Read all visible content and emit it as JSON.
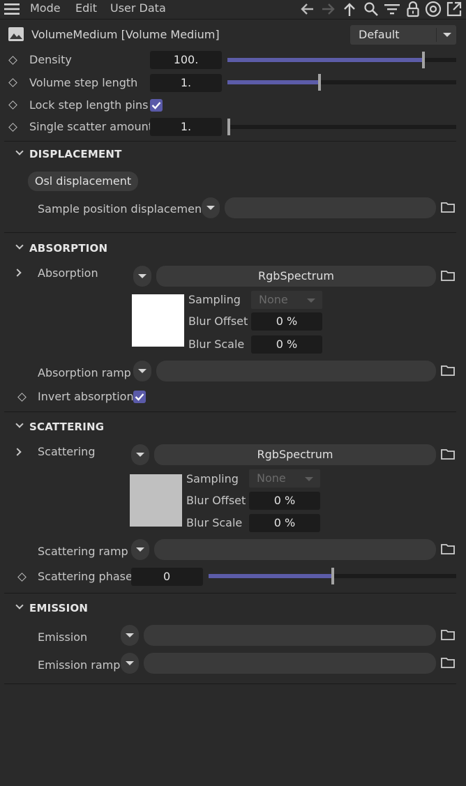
{
  "menu": {
    "mode": "Mode",
    "edit": "Edit",
    "user_data": "User Data"
  },
  "header": {
    "title": "VolumeMedium [Volume Medium]",
    "preset": "Default"
  },
  "params": {
    "density": {
      "label": "Density",
      "value": "100.",
      "fraction": 0.86
    },
    "step_length": {
      "label": "Volume step length",
      "value": "1.",
      "fraction": 0.4
    },
    "lock_pins": {
      "label": "Lock step length pins",
      "checked": true
    },
    "scatter_amount": {
      "label": "Single scatter amount",
      "value": "1.",
      "fraction": 0.0
    }
  },
  "displacement": {
    "title": "DISPLACEMENT",
    "button": "Osl displacement",
    "sample_label": "Sample position displacement"
  },
  "absorption": {
    "title": "ABSORPTION",
    "label": "Absorption",
    "shader": "RgbSpectrum",
    "sampling_label": "Sampling",
    "sampling_value": "None",
    "blur_offset_label": "Blur Offset",
    "blur_offset": "0 %",
    "blur_scale_label": "Blur Scale",
    "blur_scale": "0 %",
    "swatch_color": "#ffffff",
    "ramp_label": "Absorption ramp",
    "invert_label": "Invert absorption",
    "invert_checked": true
  },
  "scattering": {
    "title": "SCATTERING",
    "label": "Scattering",
    "shader": "RgbSpectrum",
    "sampling_label": "Sampling",
    "sampling_value": "None",
    "blur_offset_label": "Blur Offset",
    "blur_offset": "0 %",
    "blur_scale_label": "Blur Scale",
    "blur_scale": "0 %",
    "swatch_color": "#c0c0c0",
    "ramp_label": "Scattering ramp",
    "phase_label": "Scattering phase",
    "phase_value": "0",
    "phase_fraction": 0.5
  },
  "emission": {
    "title": "EMISSION",
    "label": "Emission",
    "ramp_label": "Emission ramp"
  },
  "colors": {
    "accent": "#5c5ca8",
    "background": "#2a2a2a",
    "field": "#1c1c1c"
  }
}
